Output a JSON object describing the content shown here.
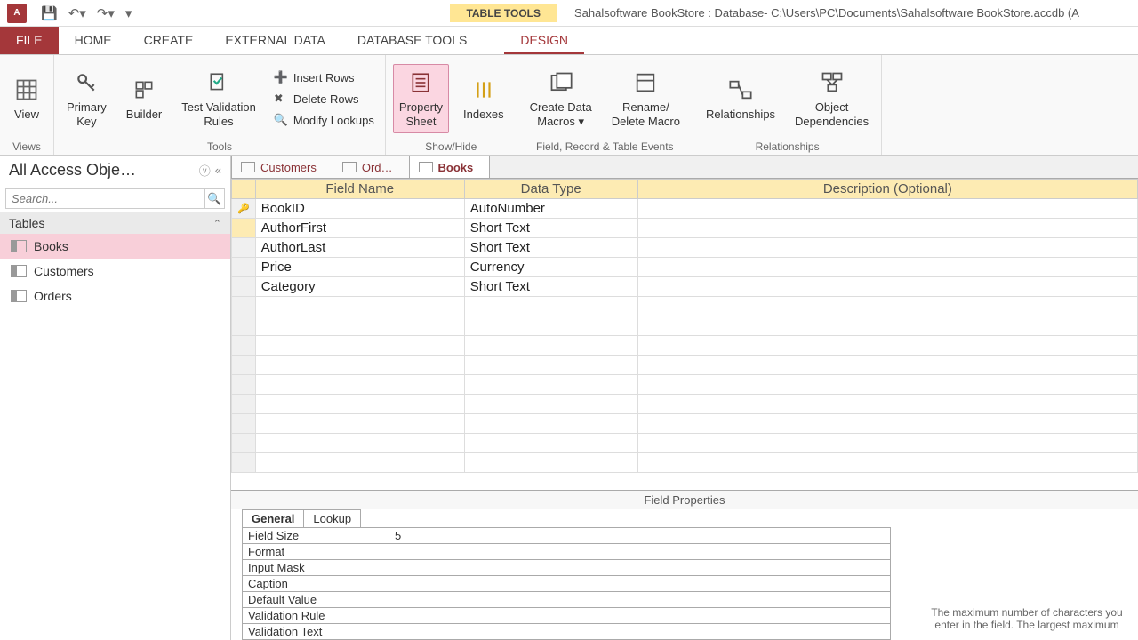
{
  "titlebar": {
    "context_group": "TABLE TOOLS",
    "title": "Sahalsoftware BookStore : Database- C:\\Users\\PC\\Documents\\Sahalsoftware BookStore.accdb (A"
  },
  "ribbon_tabs": {
    "file": "FILE",
    "home": "HOME",
    "create": "CREATE",
    "external": "EXTERNAL DATA",
    "dbtools": "DATABASE TOOLS",
    "design": "DESIGN"
  },
  "ribbon": {
    "views": {
      "view": "View",
      "group": "Views"
    },
    "tools": {
      "primary_key": "Primary\nKey",
      "builder": "Builder",
      "test_rules": "Test Validation\nRules",
      "insert_rows": "Insert Rows",
      "delete_rows": "Delete Rows",
      "modify_lookups": "Modify Lookups",
      "group": "Tools"
    },
    "showhide": {
      "property_sheet": "Property\nSheet",
      "indexes": "Indexes",
      "group": "Show/Hide"
    },
    "events": {
      "create_macros": "Create Data\nMacros ▾",
      "rename_delete": "Rename/\nDelete Macro",
      "group": "Field, Record & Table Events"
    },
    "rel": {
      "relationships": "Relationships",
      "obj_dep": "Object\nDependencies",
      "group": "Relationships"
    }
  },
  "nav": {
    "header": "All Access Obje…",
    "search_ph": "Search...",
    "group": "Tables",
    "items": [
      "Books",
      "Customers",
      "Orders"
    ]
  },
  "doc_tabs": [
    "Customers",
    "Ord…",
    "Books"
  ],
  "grid": {
    "headers": {
      "field": "Field Name",
      "type": "Data Type",
      "desc": "Description (Optional)"
    },
    "rows": [
      {
        "field": "BookID",
        "type": "AutoNumber",
        "pk": true
      },
      {
        "field": "AuthorFirst",
        "type": "Short Text",
        "hl": true
      },
      {
        "field": "AuthorLast",
        "type": "Short Text"
      },
      {
        "field": "Price",
        "type": "Currency"
      },
      {
        "field": "Category",
        "type": "Short Text"
      }
    ]
  },
  "props": {
    "title": "Field Properties",
    "tabs": {
      "general": "General",
      "lookup": "Lookup"
    },
    "rows": [
      {
        "label": "Field Size",
        "value": "5"
      },
      {
        "label": "Format",
        "value": ""
      },
      {
        "label": "Input Mask",
        "value": ""
      },
      {
        "label": "Caption",
        "value": ""
      },
      {
        "label": "Default Value",
        "value": ""
      },
      {
        "label": "Validation Rule",
        "value": ""
      },
      {
        "label": "Validation Text",
        "value": ""
      }
    ],
    "help": "The maximum number of characters you enter in the field. The largest maximum"
  }
}
